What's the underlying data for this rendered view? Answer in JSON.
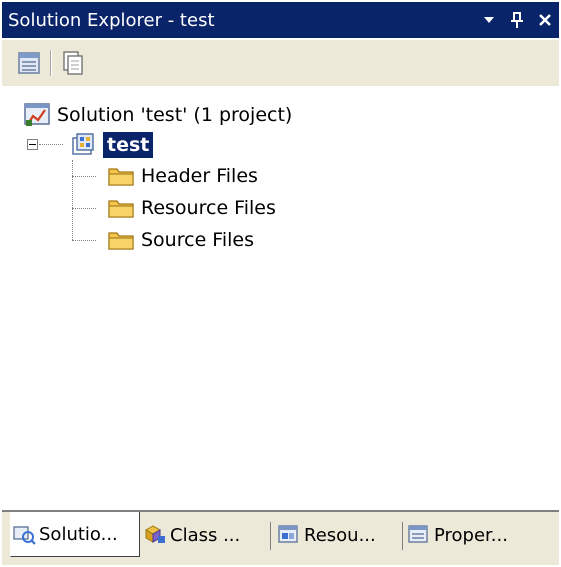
{
  "window": {
    "title": "Solution Explorer - test",
    "buttons": {
      "dropdown": "▾",
      "pin": "⊥",
      "close": "✕"
    }
  },
  "toolbar": {
    "items": [
      {
        "icon": "properties-icon"
      },
      {
        "icon": "show-all-files-icon"
      }
    ]
  },
  "tree": {
    "solution": {
      "label": "Solution 'test' (1 project)",
      "icon": "solution-icon"
    },
    "project": {
      "label": "test",
      "icon": "project-icon",
      "selected": true,
      "expanded": true
    },
    "folders": [
      {
        "label": "Header Files",
        "icon": "folder-icon"
      },
      {
        "label": "Resource Files",
        "icon": "folder-icon"
      },
      {
        "label": "Source Files",
        "icon": "folder-icon"
      }
    ]
  },
  "tabs": [
    {
      "label": "Solutio...",
      "icon": "solution-explorer-icon",
      "active": true
    },
    {
      "label": "Class ...",
      "icon": "class-view-icon",
      "active": false
    },
    {
      "label": "Resou...",
      "icon": "resource-view-icon",
      "active": false
    },
    {
      "label": "Proper...",
      "icon": "property-manager-icon",
      "active": false
    }
  ],
  "colors": {
    "titlebar": "#0a246a",
    "toolbar": "#ece9d8",
    "selection": "#0a246a",
    "folder": "#f5c64a"
  }
}
